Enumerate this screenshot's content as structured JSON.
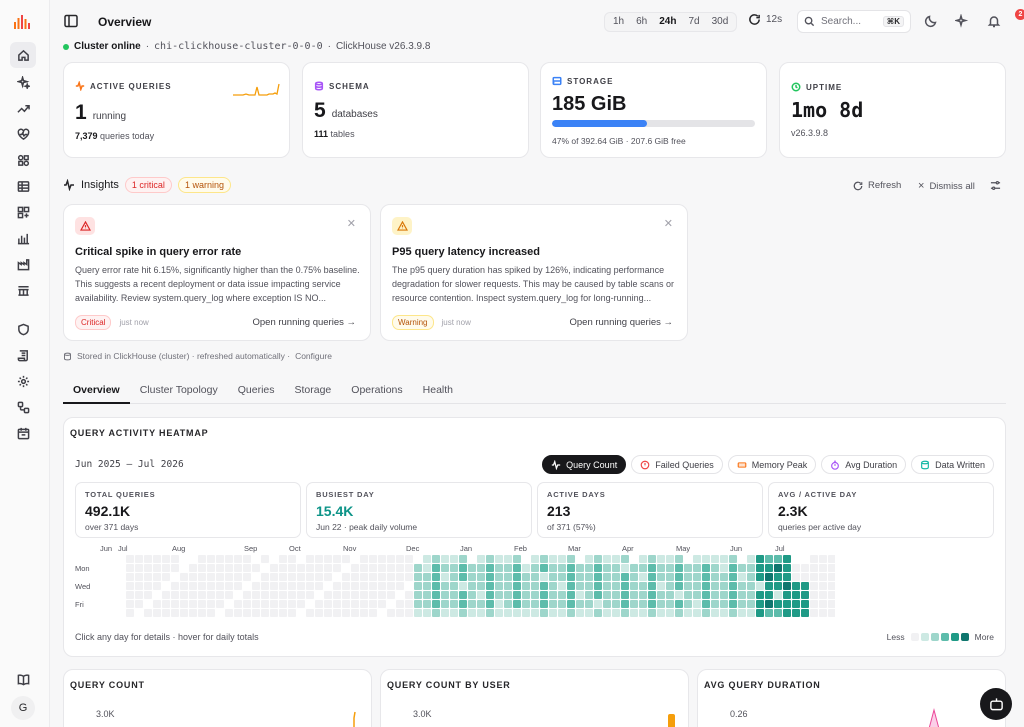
{
  "topbar": {
    "title": "Overview",
    "ranges": [
      "1h",
      "6h",
      "24h",
      "7d",
      "30d"
    ],
    "active_range": "24h",
    "refresh_interval": "12s",
    "search_placeholder": "Search...",
    "search_shortcut": "⌘K",
    "notif_count": "2"
  },
  "cluster": {
    "status": "Cluster online",
    "name": "chi-clickhouse-cluster-0-0-0",
    "version": "ClickHouse v26.3.9.8"
  },
  "stats": {
    "active_queries": {
      "label": "ACTIVE QUERIES",
      "value": "1",
      "unit": "running",
      "sub_value": "7,379",
      "sub_text": "queries today"
    },
    "schema": {
      "label": "SCHEMA",
      "value": "5",
      "unit": "databases",
      "sub_value": "111",
      "sub_text": "tables"
    },
    "storage": {
      "label": "STORAGE",
      "value": "185 GiB",
      "used_fraction": 0.47,
      "sub": "47% of 392.64 GiB · 207.6 GiB free"
    },
    "uptime": {
      "label": "UPTIME",
      "value": "1mo 8d",
      "sub": "v26.3.9.8"
    }
  },
  "insights": {
    "title": "Insights",
    "critical_badge": "1 critical",
    "warning_badge": "1 warning",
    "refresh_label": "Refresh",
    "dismiss_label": "Dismiss all",
    "cards": [
      {
        "title": "Critical spike in query error rate",
        "body": "Query error rate hit 6.15%, significantly higher than the 0.75% baseline. This suggests a recent deployment or data issue impacting service availability. Review system.query_log where exception IS NO...",
        "severity": "Critical",
        "time": "just now",
        "link": "Open running queries →"
      },
      {
        "title": "P95 query latency increased",
        "body": "The p95 query duration has spiked by 126%, indicating performance degradation for slower requests. This may be caused by table scans or resource contention. Inspect system.query_log for long-running...",
        "severity": "Warning",
        "time": "just now",
        "link": "Open running queries →"
      }
    ],
    "stored_text": "Stored in ClickHouse (cluster) · refreshed automatically ·",
    "configure": "Configure"
  },
  "tabs": [
    "Overview",
    "Cluster Topology",
    "Queries",
    "Storage",
    "Operations",
    "Health"
  ],
  "heatmap": {
    "title": "QUERY ACTIVITY HEATMAP",
    "range": "Jun 2025 — Jul 2026",
    "metrics": [
      "Query Count",
      "Failed Queries",
      "Memory Peak",
      "Avg Duration",
      "Data Written"
    ],
    "kpis": [
      {
        "label": "TOTAL QUERIES",
        "value": "492.1K",
        "sub": "over 371 days"
      },
      {
        "label": "BUSIEST DAY",
        "value": "15.4K",
        "sub": "Jun 22 · peak daily volume"
      },
      {
        "label": "ACTIVE DAYS",
        "value": "213",
        "sub": "of 371 (57%)"
      },
      {
        "label": "AVG / ACTIVE DAY",
        "value": "2.3K",
        "sub": "queries per active day"
      }
    ],
    "months": [
      "Jun",
      "Jul",
      "Aug",
      "Sep",
      "Oct",
      "Nov",
      "Dec",
      "Jan",
      "Feb",
      "Mar",
      "Apr",
      "May",
      "Jun",
      "Jul"
    ],
    "day_labels": [
      "Mon",
      "Wed",
      "Fri"
    ],
    "footer": "Click any day for details · hover for daily totals",
    "legend_less": "Less",
    "legend_more": "More",
    "colors": [
      "#f1f1f3",
      "#cde9e3",
      "#9ed6cb",
      "#5dbcab",
      "#1f9a86",
      "#0f766e"
    ]
  },
  "charts": {
    "query_count": {
      "title": "QUERY COUNT",
      "y_top": "3.0K"
    },
    "by_user": {
      "title": "QUERY COUNT BY USER",
      "y_top": "3.0K"
    },
    "avg_duration": {
      "title": "AVG QUERY DURATION",
      "y_top": "0.26"
    }
  },
  "sidebar": {
    "user_initial": "G"
  }
}
